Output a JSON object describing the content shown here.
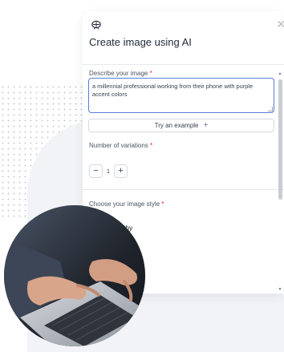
{
  "dialog": {
    "title": "Create image using AI",
    "icon": "ai-brain-icon",
    "close_icon": "close-icon"
  },
  "prompt": {
    "label": "Describe your image",
    "required_mark": "*",
    "value": "a millennial professional working from their phone with purple accent colors"
  },
  "try_example": {
    "label": "Try an example",
    "icon": "+"
  },
  "variations": {
    "label": "Number of variations",
    "required_mark": "*",
    "minus": "−",
    "value": "1",
    "plus": "+"
  },
  "style": {
    "label": "Choose your image style",
    "required_mark": "*",
    "selected": "Photography"
  },
  "colors": {
    "accent": "#5b7bd5",
    "required": "#e11d48"
  }
}
